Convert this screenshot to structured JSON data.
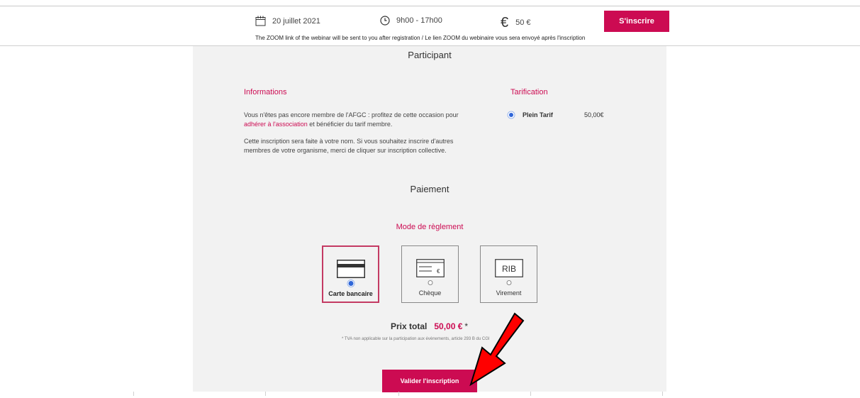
{
  "event": {
    "date": "20 juillet 2021",
    "time": "9h00 - 17h00",
    "price": "50 €",
    "register_label": "S'inscrire",
    "notice": "The ZOOM link of the webinar will be sent to you after registration / Le lien ZOOM du webinaire vous sera envoyé après l'inscription"
  },
  "participant": {
    "title": "Participant",
    "info_label": "Informations",
    "para1_pre": "Vous n'êtes pas encore membre de l'AFGC : profitez de cette occasion pour ",
    "para1_link": "adhérer à l'association",
    "para1_post": " et bénéficier du tarif membre.",
    "para2": "Cette inscription sera faite à votre nom. Si vous souhaitez inscrire d'autres membres de votre organisme, merci de cliquer sur inscription collective.",
    "tarif_label": "Tarification",
    "tarif_option": "Plein Tarif",
    "tarif_price": "50,00€"
  },
  "payment": {
    "title": "Paiement",
    "mode_label": "Mode de règlement",
    "options": [
      {
        "label": "Carte bancaire",
        "selected": true,
        "icon": "credit-card-icon"
      },
      {
        "label": "Chèque",
        "selected": false,
        "icon": "cheque-icon"
      },
      {
        "label": "Virement",
        "selected": false,
        "icon": "rib-icon",
        "icon_text": "RIB"
      }
    ],
    "total_label": "Prix total",
    "total_value": "50,00 €",
    "total_star": "*",
    "tva_note": "* TVA non applicable sur la participation aux évènements, article 293 B du CGI",
    "submit_label": "Valider l'inscription"
  },
  "colors": {
    "accent": "#cc0b52",
    "panel_bg": "#f2f2f2",
    "radio_blue": "#2f66d8",
    "arrow_red": "#ff0000"
  }
}
